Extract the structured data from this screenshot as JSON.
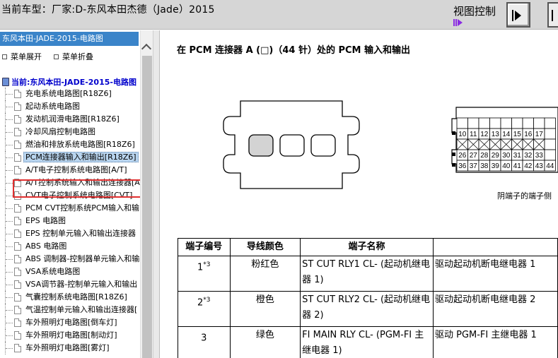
{
  "header": {
    "title": "当前车型：厂家:D-东风本田杰德（Jade）2015",
    "view_control_label": "视图控制"
  },
  "sidebar": {
    "title": "东风本田-JADE-2015-电路图",
    "expand_all": "菜单展开",
    "collapse_all": "菜单折叠",
    "root": "当前:东风本田-JADE-2015-电路图",
    "items": [
      {
        "label": "充电系统电路图[R18Z6]"
      },
      {
        "label": "起动系统电路图"
      },
      {
        "label": "发动机润滑电路图[R18Z6]"
      },
      {
        "label": "冷却风扇控制电路图"
      },
      {
        "label": "燃油和排放系统电路图[R18Z6]"
      },
      {
        "label": "PCM连接器输入和输出[R18Z6]"
      },
      {
        "label": "A/T电子控制系统电路图[A/T]"
      },
      {
        "label": "A/T控制系统输入和输出连接器[A"
      },
      {
        "label": "CVT电子控制系统电路图[CVT]"
      },
      {
        "label": "PCM CVT控制系统PCM输入和输"
      },
      {
        "label": "EPS 电路图"
      },
      {
        "label": "EPS 控制单元输入和输出连接器"
      },
      {
        "label": "ABS 电路图"
      },
      {
        "label": "ABS 调制器-控制器单元输入和输"
      },
      {
        "label": "VSA系统电路图"
      },
      {
        "label": "VSA调节器-控制单元输入和输出"
      },
      {
        "label": "气囊控制系统电路图[R18Z6]"
      },
      {
        "label": "气温控制单元输入和输出连接器["
      },
      {
        "label": "车外照明灯电路图[倒车灯]"
      },
      {
        "label": "车外照明灯电路图[制动灯]"
      },
      {
        "label": "车外照明灯电路图[雾灯]"
      }
    ],
    "selected_index": 5
  },
  "main": {
    "heading": "在 PCM 连接器 A (□)（44 针）处的 PCM 输入和输出",
    "connector_caption": "阴端子的端子侧",
    "pin_rows": [
      [
        "",
        "",
        "",
        "",
        "",
        "",
        "",
        "",
        ""
      ],
      [
        "10",
        "11",
        "12",
        "13",
        "14",
        "15",
        "16",
        "17",
        ""
      ],
      [
        "",
        "",
        "",
        "",
        "",
        "",
        "",
        "",
        ""
      ],
      [
        "26",
        "27",
        "28",
        "29",
        "30",
        "31",
        "32",
        "33",
        ""
      ],
      [
        "36",
        "37",
        "38",
        "39",
        "40",
        "41",
        "42",
        "43",
        "44"
      ]
    ],
    "table": {
      "headers": [
        "端子编号",
        "导线颜色",
        "端子名称",
        ""
      ],
      "rows": [
        {
          "no": "1",
          "sup": "*3",
          "color": "粉红色",
          "name": "ST CUT RLY1 CL- (起动机继电器 1)",
          "desc": "驱动起动机断电继电器 1"
        },
        {
          "no": "2",
          "sup": "*3",
          "color": "橙色",
          "name": "ST CUT RLY2 CL- (起动机继电器 2)",
          "desc": "驱动起动机断电继电器 2"
        },
        {
          "no": "3",
          "sup": "",
          "color": "绿色",
          "name": "FI MAIN RLY CL- (PGM-FI 主继电器 1)",
          "desc": "驱动 PGM-FI 主继电器 1"
        }
      ]
    }
  },
  "colors": {
    "header_bg": "#d6d6d6",
    "tree_title_bg": "#3a84c9",
    "selection_box": "#e03030",
    "arrow_accent": "#8a2be2"
  }
}
